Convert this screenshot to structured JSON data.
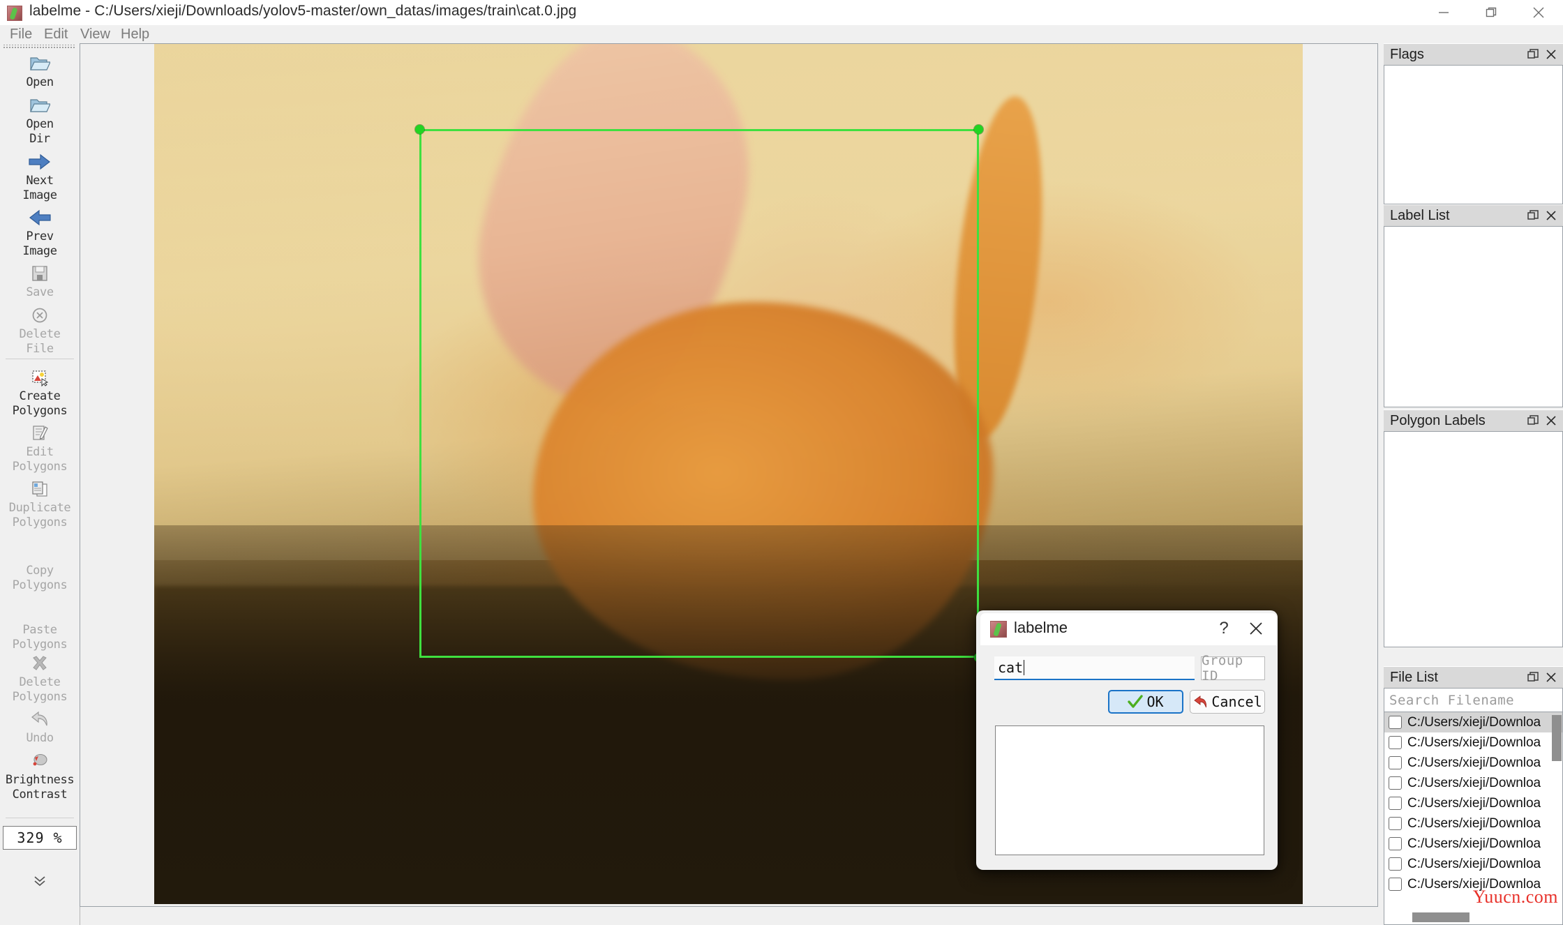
{
  "window": {
    "title": "labelme - C:/Users/xieji/Downloads/yolov5-master/own_datas/images/train\\cat.0.jpg",
    "app_icon": "labelme-icon",
    "minimize": "minimize-icon",
    "maximize": "restore-icon",
    "close": "close-icon"
  },
  "menubar": {
    "items": [
      {
        "label": "File"
      },
      {
        "label": "Edit"
      },
      {
        "label": "View"
      },
      {
        "label": "Help"
      }
    ]
  },
  "toolbar": {
    "items": [
      {
        "label": "Open",
        "icon": "open-folder-icon",
        "enabled": true
      },
      {
        "label": "Open\nDir",
        "icon": "open-folder-icon",
        "enabled": true
      },
      {
        "label": "Next\nImage",
        "icon": "arrow-right-icon",
        "enabled": true
      },
      {
        "label": "Prev\nImage",
        "icon": "arrow-left-icon",
        "enabled": true
      },
      {
        "label": "Save",
        "icon": "save-floppy-icon",
        "enabled": false
      },
      {
        "label": "Delete\nFile",
        "icon": "delete-circle-icon",
        "enabled": false
      },
      {
        "label": "Create\nPolygons",
        "icon": "create-polygon-icon",
        "enabled": true
      },
      {
        "label": "Edit\nPolygons",
        "icon": "edit-polygon-icon",
        "enabled": false
      },
      {
        "label": "Duplicate\nPolygons",
        "icon": "duplicate-icon",
        "enabled": false
      },
      {
        "label": "Copy\nPolygons",
        "icon": "copy-icon",
        "enabled": false
      },
      {
        "label": "Paste\nPolygons",
        "icon": "paste-icon",
        "enabled": false
      },
      {
        "label": "Delete\nPolygons",
        "icon": "delete-x-icon",
        "enabled": false
      },
      {
        "label": "Undo",
        "icon": "undo-arrow-icon",
        "enabled": false
      },
      {
        "label": "Brightness\nContrast",
        "icon": "brightness-icon",
        "enabled": true
      }
    ],
    "zoom_value": "329 %",
    "overflow": "chevron-double-down-icon"
  },
  "canvas": {
    "image_name": "cat.0.jpg",
    "shape": {
      "type": "rectangle",
      "stroke_color": "#3fe03f",
      "vertices": [
        "top-left-vertex",
        "top-right-vertex",
        "bottom-right-vertex"
      ]
    }
  },
  "dock": {
    "panels": [
      {
        "title": "Flags",
        "float": "float-icon",
        "close": "close-icon"
      },
      {
        "title": "Label List",
        "float": "float-icon",
        "close": "close-icon"
      },
      {
        "title": "Polygon Labels",
        "float": "float-icon",
        "close": "close-icon"
      },
      {
        "title": "File List",
        "float": "float-icon",
        "close": "close-icon"
      }
    ],
    "file_list": {
      "search_placeholder": "Search Filename",
      "rows": [
        {
          "text": "C:/Users/xieji/Downloa",
          "selected": true
        },
        {
          "text": "C:/Users/xieji/Downloa",
          "selected": false
        },
        {
          "text": "C:/Users/xieji/Downloa",
          "selected": false
        },
        {
          "text": "C:/Users/xieji/Downloa",
          "selected": false
        },
        {
          "text": "C:/Users/xieji/Downloa",
          "selected": false
        },
        {
          "text": "C:/Users/xieji/Downloa",
          "selected": false
        },
        {
          "text": "C:/Users/xieji/Downloa",
          "selected": false
        },
        {
          "text": "C:/Users/xieji/Downloa",
          "selected": false
        },
        {
          "text": "C:/Users/xieji/Downloa",
          "selected": false
        }
      ]
    },
    "watermark": "Yuucn.com"
  },
  "dialog": {
    "title": "labelme",
    "app_icon": "labelme-icon",
    "help": "?",
    "close": "close-icon",
    "label_value": "cat",
    "group_id_placeholder": "Group ID",
    "ok_label": "OK",
    "cancel_label": "Cancel",
    "ok_icon": "green-check-icon",
    "cancel_icon": "red-undo-arrow-icon"
  },
  "colors": {
    "accent_blue": "#1a73c7",
    "shape_green": "#3fe03f",
    "watermark_red": "#e8312a"
  }
}
